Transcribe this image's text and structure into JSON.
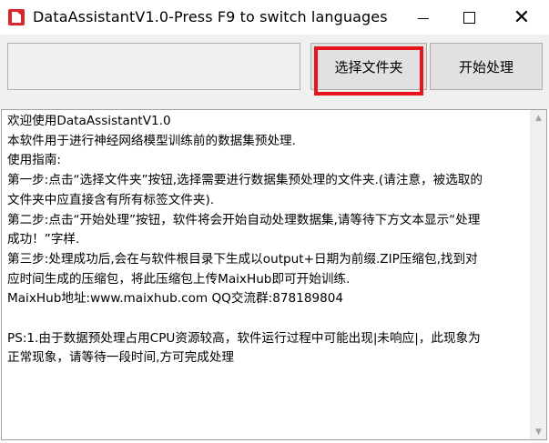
{
  "window": {
    "title": "DataAssistantV1.0-Press F9 to switch languages",
    "minimize_icon": "minimize-icon",
    "maximize_icon": "maximize-icon",
    "close_glyph": "✕"
  },
  "toolbar": {
    "folder_path_value": "",
    "select_folder_label": "选择文件夹",
    "start_process_label": "开始处理"
  },
  "log": {
    "lines": [
      "欢迎使用DataAssistantV1.0",
      "本软件用于进行神经网络模型训练前的数据集预处理.",
      "使用指南:",
      "第一步:点击“选择文件夹”按钮,选择需要进行数据集预处理的文件夹.(请注意，被选取的",
      "文件夹中应直接含有所有标签文件夹).",
      "第二步:点击“开始处理”按钮，软件将会开始自动处理数据集,请等待下方文本显示“处理",
      "成功！”字样.",
      "第三步:处理成功后,会在与软件根目录下生成以output+日期为前缀.ZIP压缩包,找到对",
      "应时间生成的压缩包，将此压缩包上传MaixHub即可开始训练.",
      "MaixHub地址:www.maixhub.com   QQ交流群:878189804",
      "",
      "PS:1.由于数据预处理占用CPU资源较高，软件运行过程中可能出现|未响应|，此现象为",
      "正常现象，请等待一段时间,方可完成处理"
    ]
  },
  "scrollbar": {
    "up_glyph": "▲",
    "down_glyph": "▼"
  },
  "colors": {
    "highlight_border": "#e8141b",
    "app_icon": "#d9262b"
  }
}
